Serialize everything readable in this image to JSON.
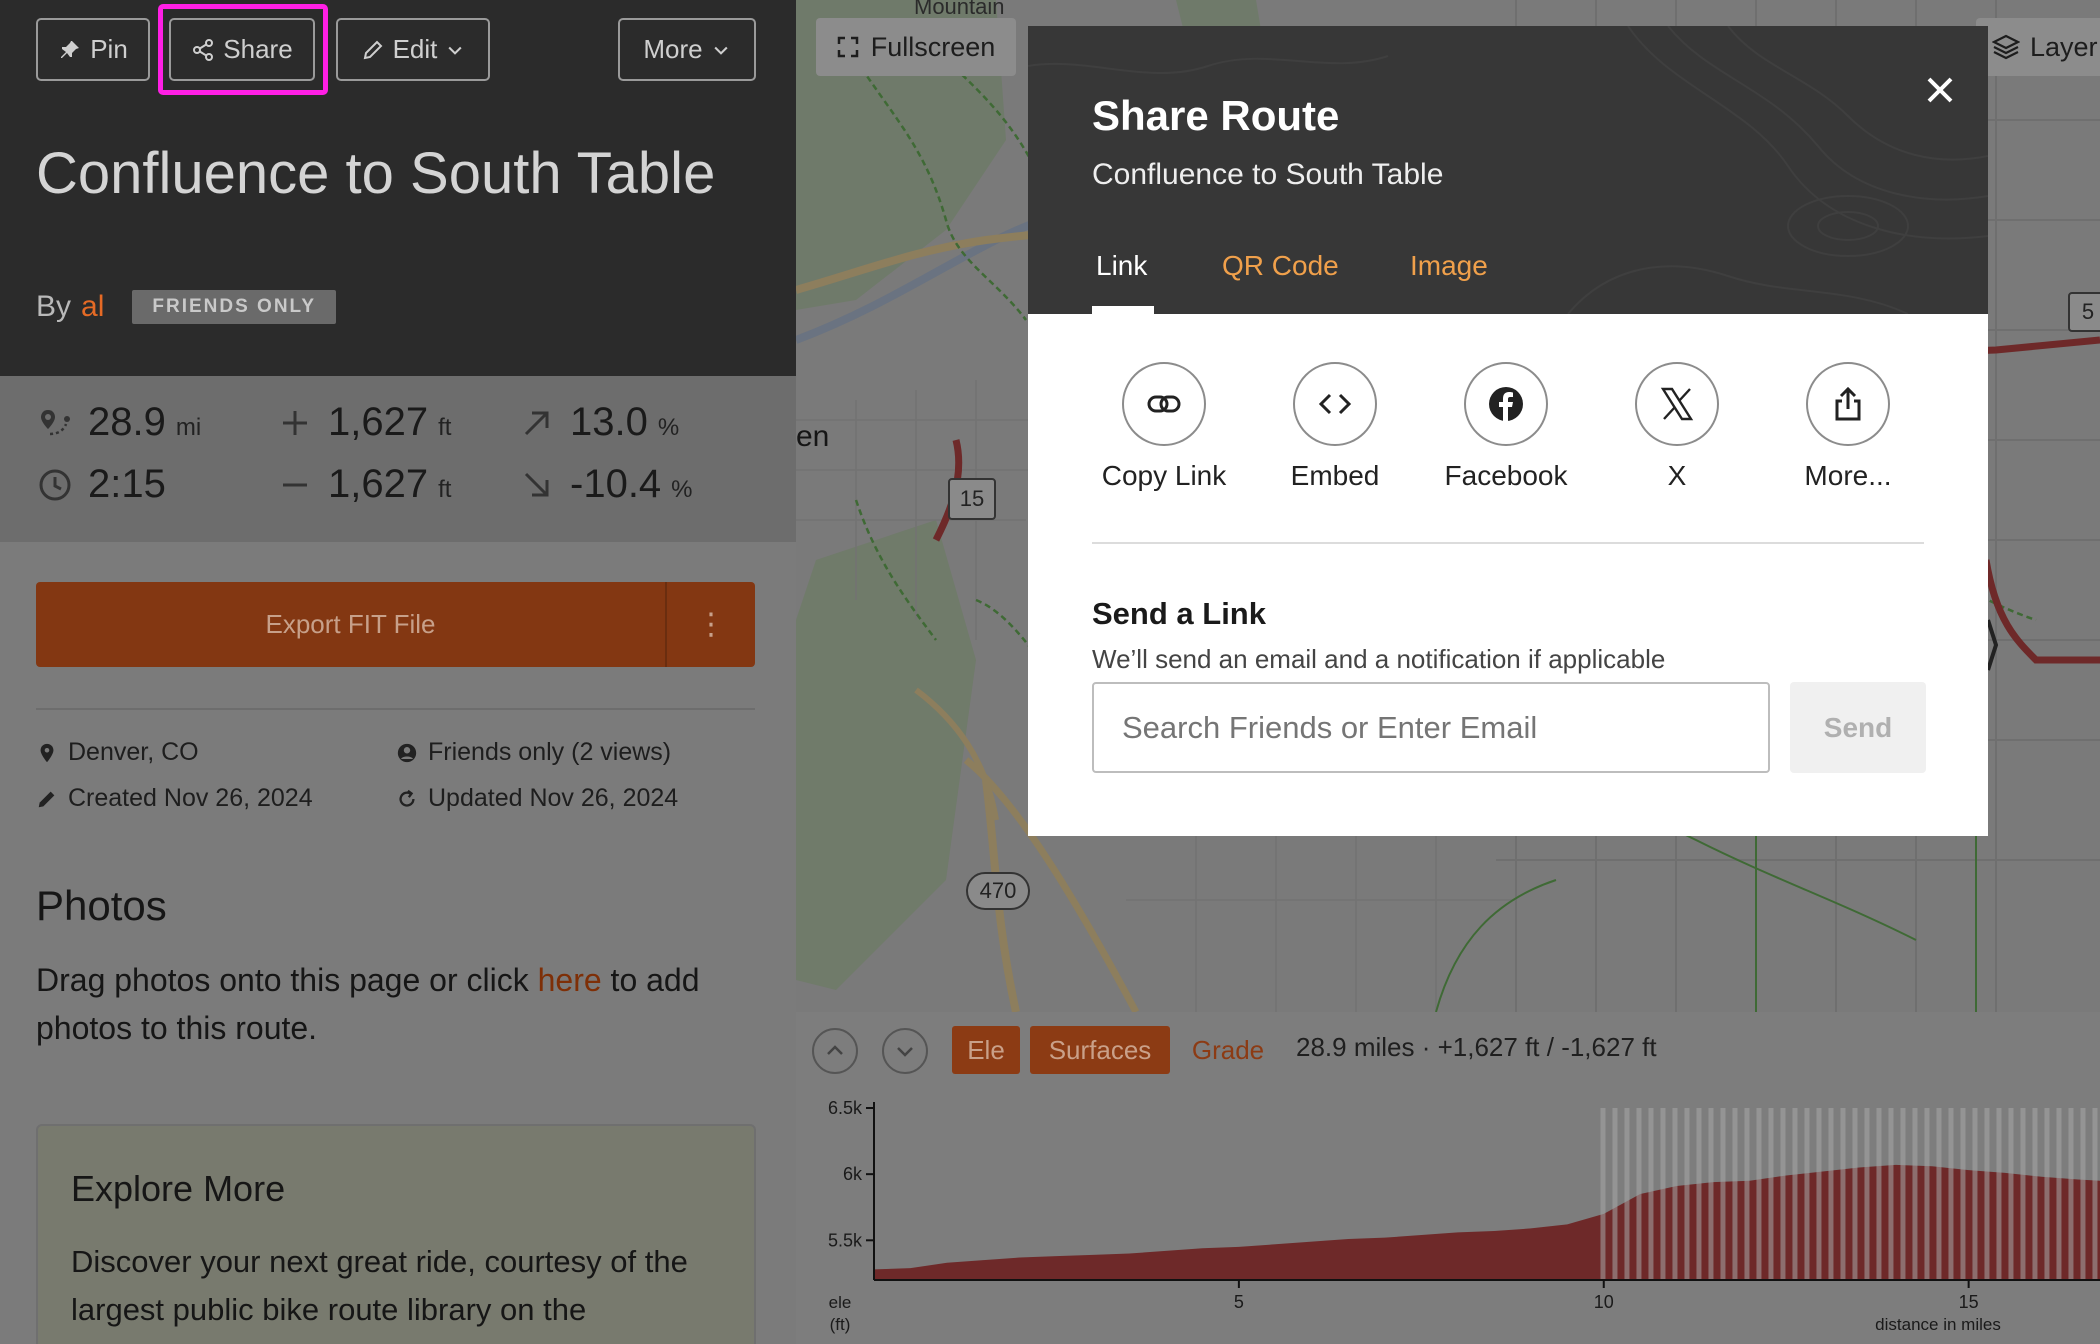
{
  "toolbar": {
    "pin_label": "Pin",
    "share_label": "Share",
    "edit_label": "Edit",
    "more_label": "More"
  },
  "route": {
    "title": "Confluence to South Table",
    "by_prefix": "By",
    "author": "al",
    "privacy_badge": "FRIENDS ONLY"
  },
  "stats": {
    "distance": {
      "value": "28.9",
      "unit": "mi"
    },
    "time": {
      "value": "2:15"
    },
    "elevation_gain": {
      "value": "1,627",
      "unit": "ft"
    },
    "elevation_loss": {
      "value": "1,627",
      "unit": "ft"
    },
    "max_grade": {
      "value": "13.0",
      "unit": "%"
    },
    "min_grade": {
      "value": "-10.4",
      "unit": "%"
    }
  },
  "export": {
    "label": "Export FIT File",
    "menu_glyph": "⋮"
  },
  "meta": {
    "location": "Denver, CO",
    "visibility": "Friends only (2 views)",
    "created": "Created Nov 26, 2024",
    "updated": "Updated Nov 26, 2024"
  },
  "photos": {
    "heading": "Photos",
    "text_before": "Drag photos onto this page or click ",
    "link": "here",
    "text_after": " to add photos to this route."
  },
  "explore": {
    "heading": "Explore More",
    "text": "Discover your next great ride, courtesy of the largest public bike route library on the"
  },
  "map": {
    "fullscreen_label": "Fullscreen",
    "layers_label": "Layer",
    "place_label_partial": "en",
    "mountain_label": "Mountain",
    "shields": [
      "15",
      "470",
      "5"
    ]
  },
  "elevation": {
    "tabs": {
      "ele": "Ele",
      "surfaces": "Surfaces",
      "grade": "Grade"
    },
    "summary": "28.9 miles · +1,627 ft / -1,627 ft",
    "y_axis_title": "ele\n(ft)",
    "x_axis_title": "distance in miles"
  },
  "modal": {
    "title": "Share Route",
    "subtitle": "Confluence to South Table",
    "tabs": {
      "link": "Link",
      "qr": "QR Code",
      "image": "Image"
    },
    "options": {
      "copy": "Copy Link",
      "embed": "Embed",
      "facebook": "Facebook",
      "x": "X",
      "more": "More..."
    },
    "send_heading": "Send a Link",
    "send_subtitle": "We’ll send an email and a notification if applicable",
    "send_placeholder": "Search Friends or Enter Email",
    "send_button": "Send"
  },
  "colors": {
    "accent_orange": "#e56a25",
    "tab_orange": "#f0a04b",
    "export_button": "#833712",
    "route_red": "#c0392b",
    "highlight": "#ff1fe5"
  },
  "chart_data": {
    "type": "area",
    "x_unit": "miles",
    "y_unit": "ft",
    "x_ticks": [
      5,
      10,
      15
    ],
    "y_ticks": [
      "5.5k",
      "6k",
      "6.5k"
    ],
    "ylim": [
      5200,
      6500
    ],
    "xlim": [
      0,
      16.8
    ],
    "xlabel": "distance in miles",
    "ylabel": "ele\n(ft)",
    "x": [
      0,
      0.5,
      1,
      1.5,
      2,
      2.5,
      3,
      3.5,
      4,
      4.5,
      5,
      5.5,
      6,
      6.5,
      7,
      7.5,
      8,
      8.5,
      9,
      9.5,
      10,
      10.5,
      11,
      11.5,
      12,
      12.5,
      13,
      13.5,
      14,
      14.5,
      15,
      15.5,
      16,
      16.5,
      16.8
    ],
    "y": [
      5280,
      5290,
      5330,
      5350,
      5370,
      5380,
      5390,
      5400,
      5420,
      5440,
      5450,
      5470,
      5490,
      5510,
      5520,
      5540,
      5560,
      5570,
      5590,
      5620,
      5700,
      5850,
      5910,
      5940,
      5950,
      5990,
      6020,
      6050,
      6070,
      6060,
      6030,
      6010,
      5980,
      5960,
      5950
    ],
    "highlight_from_x": 9.9
  }
}
